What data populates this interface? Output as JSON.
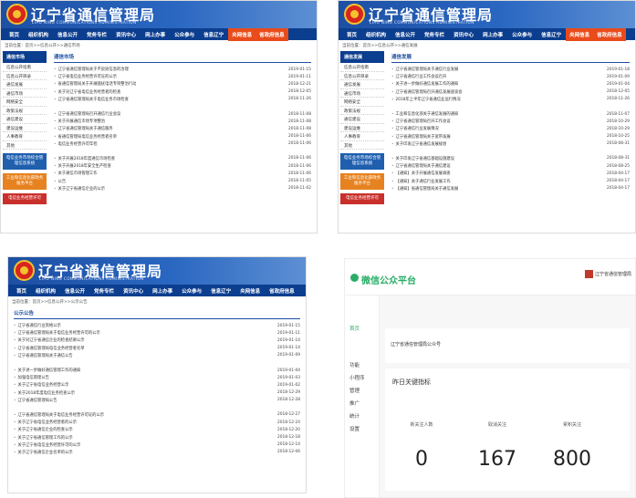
{
  "site": {
    "title": "辽宁省通信管理局",
    "subtitle": "LIAO NING COMMUNICATIONS ADMINISTRATION"
  },
  "nav": [
    "首页",
    "组织机构",
    "信息公开",
    "党务专栏",
    "资讯中心",
    "网上办事",
    "公众参与",
    "信息辽宁",
    "央网信息",
    "省政府信息"
  ],
  "panel1": {
    "crumb": "当前位置：首页>>信息公开>>通信市场",
    "side_header": "通信市场",
    "side_items": [
      "信息公开指南",
      "信息公开目录",
      "通信发展",
      "通信市场",
      "网络安全",
      "政策法规",
      "通信建设",
      "建设运维",
      "人事教育",
      "其他"
    ],
    "side_buttons": [
      "电信业务市场综合管理信息系统",
      "工业和信息化部政务服务平台",
      "电信业务经营许可"
    ],
    "main_header": "通信市场",
    "group1": [
      {
        "t": "辽宁省通信管理局关于不良短信息的治理",
        "d": "2019-01-15"
      },
      {
        "t": "辽宁省电信业务经营许可证的公示",
        "d": "2019-01-11"
      },
      {
        "t": "省通信管理局关于开展骚扰电话专项整治行动",
        "d": "2018-12-21"
      },
      {
        "t": "关于对辽宁省电信业务经营者的检查",
        "d": "2018-12-05"
      },
      {
        "t": "辽宁省通信管理局关于电信业务市场检查",
        "d": "2018-11-26"
      }
    ],
    "group2": [
      {
        "t": "辽宁省通信管理局召开通信行业会议",
        "d": "2018-11-08"
      },
      {
        "t": "关于开展通信市场专项整治",
        "d": "2018-11-08"
      },
      {
        "t": "辽宁省通信管理局关于通信服务",
        "d": "2018-11-08"
      },
      {
        "t": "省通信管理局电信业务经营者名单",
        "d": "2018-11-06"
      },
      {
        "t": "电信业务经营许可年检",
        "d": "2018-11-06"
      }
    ],
    "group3": [
      {
        "t": "关于开展2018年度通信市场检查",
        "d": "2018-11-06"
      },
      {
        "t": "关于开展2018年安全生产检查",
        "d": "2018-11-06"
      },
      {
        "t": "关于通信市场管理工作",
        "d": "2018-11-06"
      },
      {
        "t": "公告",
        "d": "2018-11-05"
      },
      {
        "t": "关于辽宁省通信企业的公示",
        "d": "2018-11-02"
      }
    ]
  },
  "panel2": {
    "crumb": "当前位置：首页>>信息公开>>通信发展",
    "side_header": "通信发展",
    "side_items": [
      "信息公开指南",
      "信息公开目录",
      "通信发展",
      "通信市场",
      "网络安全",
      "政策法规",
      "通信建设",
      "建设运维",
      "人事教育",
      "其他"
    ],
    "side_buttons": [
      "电信业务市场综合管理信息系统",
      "工业和信息化部政务服务平台",
      "电信业务经营许可"
    ],
    "main_header": "通信发展",
    "group1": [
      {
        "t": "辽宁省通信管理局关于通信行业发展",
        "d": "2019-01-18"
      },
      {
        "t": "辽宁省通信行业工作会议召开",
        "d": "2019-01-09"
      },
      {
        "t": "关于进一步做好通信发展工作的通知",
        "d": "2019-01-04"
      },
      {
        "t": "辽宁省通信管理局召开通信发展座谈会",
        "d": "2018-12-05"
      },
      {
        "t": "2018年上半年辽宁省通信业运行情况",
        "d": "2018-11-26"
      }
    ],
    "group2": [
      {
        "t": "工业和信息化部关于通信发展的通知",
        "d": "2018-11-07"
      },
      {
        "t": "辽宁省通信管理局召开工作会议",
        "d": "2018-10-29"
      },
      {
        "t": "辽宁省通信行业发展情况",
        "d": "2018-10-29"
      },
      {
        "t": "辽宁省通信管理局关于宽带发展",
        "d": "2018-10-25"
      },
      {
        "t": "关于印发辽宁省通信发展规划",
        "d": "2018-08-31"
      }
    ],
    "group3": [
      {
        "t": "关于印发辽宁省通信基础设施建设",
        "d": "2018-08-31"
      },
      {
        "t": "辽宁省通信管理局关于通信建设",
        "d": "2018-08-25"
      },
      {
        "t": "【通知】关于开展通信发展调查",
        "d": "2018-04-17"
      },
      {
        "t": "【通知】关于通信行业发展工作",
        "d": "2018-04-17"
      },
      {
        "t": "【通知】省通信管理局关于通信发展",
        "d": "2018-04-17"
      }
    ]
  },
  "panel3": {
    "crumb": "当前位置：首页>>信息公开>>公示公告",
    "main_header": "公示公告",
    "group1": [
      {
        "t": "辽宁省通信行业资格公示",
        "d": "2019-01-15"
      },
      {
        "t": "辽宁省通信管理局关于电信业务经营许可的公示",
        "d": "2019-01-11"
      },
      {
        "t": "关于对辽宁省通信企业的检查结果公示",
        "d": "2019-01-14"
      },
      {
        "t": "辽宁省通信管理局电信业务经营者名单",
        "d": "2019-01-14"
      },
      {
        "t": "辽宁省通信管理局关于通信公告",
        "d": "2019-01-09"
      }
    ],
    "group2": [
      {
        "t": "关于进一步做好通信管理工作的通知",
        "d": "2019-01-04"
      },
      {
        "t": "加强电信管理公告",
        "d": "2019-01-03"
      },
      {
        "t": "关于辽宁省电信业务经营公示",
        "d": "2019-01-02"
      },
      {
        "t": "关于2018年度电信业务检查公示",
        "d": "2018-12-29"
      },
      {
        "t": "辽宁省通信管理局公告",
        "d": "2018-12-28"
      }
    ],
    "group3": [
      {
        "t": "辽宁省通信管理局关于电信业务经营许可证的公示",
        "d": "2018-12-27"
      },
      {
        "t": "关于辽宁省电信业务经营者的公示",
        "d": "2018-12-24"
      },
      {
        "t": "关于辽宁省通信企业的检查公示",
        "d": "2018-12-20"
      },
      {
        "t": "关于辽宁省通信管理工作的公示",
        "d": "2018-12-18"
      },
      {
        "t": "关于辽宁省电信业务经营许可的公示",
        "d": "2018-12-14"
      },
      {
        "t": "关于辽宁省通信企业名单的公示",
        "d": "2018-12-06"
      }
    ]
  },
  "wechat": {
    "title": "微信公众平台",
    "user": "辽宁省通信管理局",
    "side": {
      "home": "首页",
      "group_items": [
        "功能",
        "小程序",
        "管理",
        "推广",
        "统计",
        "设置"
      ]
    },
    "notice": "辽宁省通信管理局公众号",
    "overview_label": "昨日关键指标",
    "stats": [
      {
        "k": "新关注人数",
        "v": "0"
      },
      {
        "k": "取消关注",
        "v": "167"
      },
      {
        "k": "累积关注",
        "v": "800"
      }
    ]
  }
}
